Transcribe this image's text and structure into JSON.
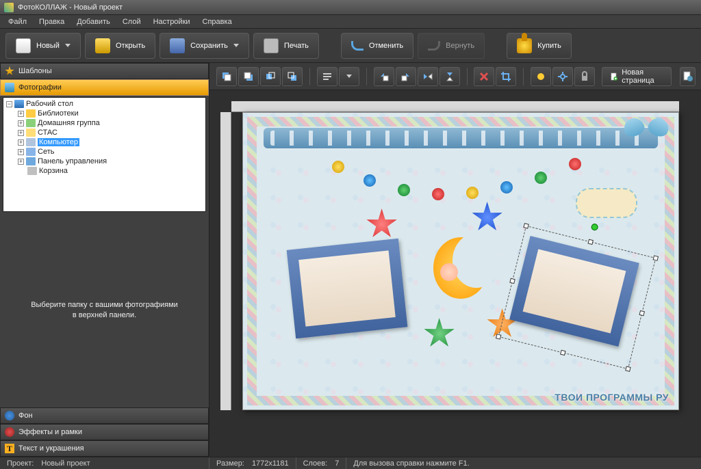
{
  "window": {
    "title": "ФотоКОЛЛАЖ - Новый проект"
  },
  "menu": {
    "items": [
      "Файл",
      "Правка",
      "Добавить",
      "Слой",
      "Настройки",
      "Справка"
    ]
  },
  "toolbar": {
    "new": "Новый",
    "open": "Открыть",
    "save": "Сохранить",
    "print": "Печать",
    "undo": "Отменить",
    "redo": "Вернуть",
    "buy": "Купить"
  },
  "sidebar": {
    "templates": "Шаблоны",
    "photos": "Фотографии",
    "background": "Фон",
    "effects": "Эффекты и рамки",
    "text": "Текст и украшения",
    "hint_line1": "Выберите папку с вашими фотографиями",
    "hint_line2": "в верхней панели.",
    "text_icon_glyph": "T"
  },
  "tree": {
    "root": "Рабочий стол",
    "items": [
      {
        "label": "Библиотеки",
        "icon": "folder",
        "indent": 1,
        "toggle": "+"
      },
      {
        "label": "Домашняя группа",
        "icon": "home",
        "indent": 1,
        "toggle": "+"
      },
      {
        "label": "СТАС",
        "icon": "user",
        "indent": 1,
        "toggle": "+"
      },
      {
        "label": "Компьютер",
        "icon": "pc",
        "indent": 1,
        "toggle": "+",
        "selected": true
      },
      {
        "label": "Сеть",
        "icon": "net",
        "indent": 1,
        "toggle": "+"
      },
      {
        "label": "Панель управления",
        "icon": "cp",
        "indent": 1,
        "toggle": "+"
      },
      {
        "label": "Корзина",
        "icon": "bin",
        "indent": 1,
        "toggle": ""
      }
    ]
  },
  "canvas_toolbar": {
    "new_page": "Новая страница"
  },
  "canvas": {
    "watermark": "ТВОИ ПРОГРАММЫ РУ"
  },
  "status": {
    "project_label": "Проект:",
    "project_value": "Новый проект",
    "size_label": "Размер:",
    "size_value": "1772x1181",
    "layers_label": "Слоев:",
    "layers_value": "7",
    "help": "Для вызова справки нажмите F1."
  }
}
